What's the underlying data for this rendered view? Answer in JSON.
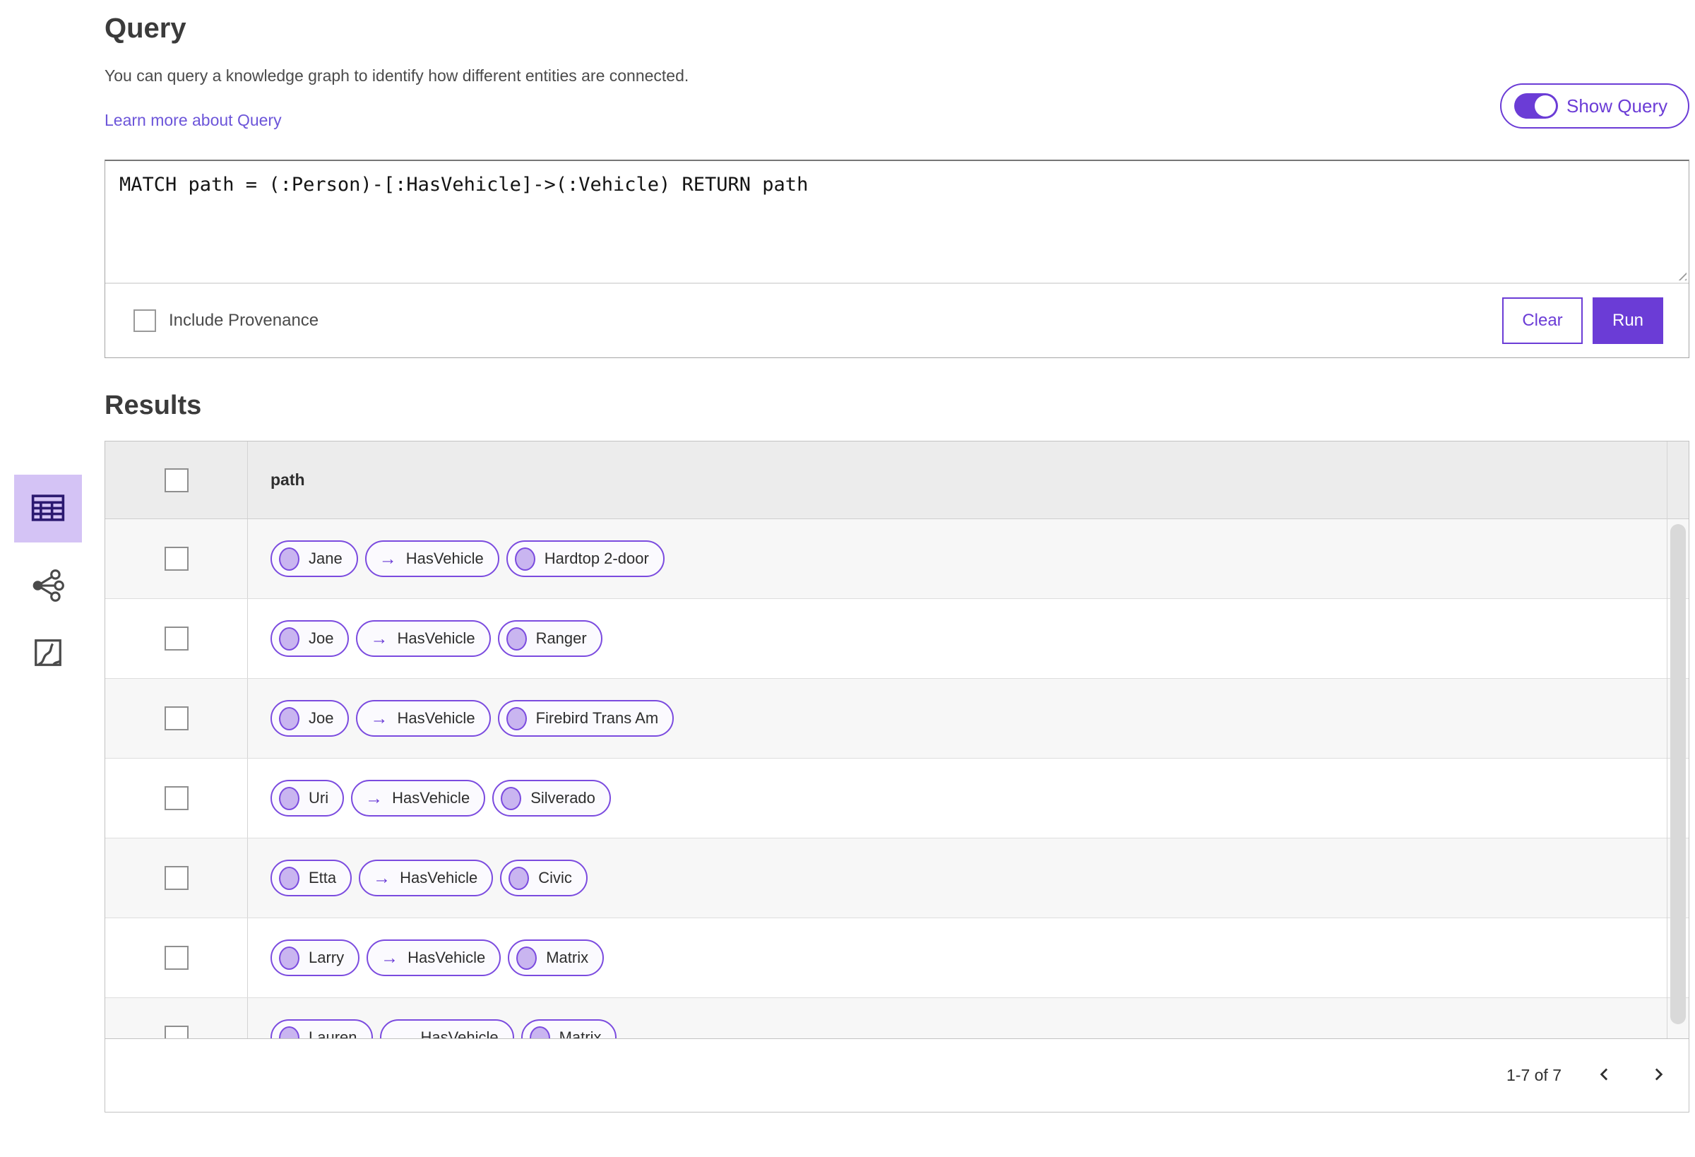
{
  "header": {
    "title": "Query",
    "description": "You can query a knowledge graph to identify how different entities are connected.",
    "learn_more_link": "Learn more about Query",
    "show_query_label": "Show Query",
    "show_query_on": true
  },
  "query_editor": {
    "query_text": "MATCH path = (:Person)-[:HasVehicle]->(:Vehicle) RETURN path",
    "include_provenance_label": "Include Provenance",
    "include_provenance_checked": false,
    "clear_button_label": "Clear",
    "run_button_label": "Run"
  },
  "results": {
    "title": "Results",
    "columns": [
      "path"
    ],
    "select_all_checked": false,
    "relationship_arrow": "→",
    "rows": [
      {
        "source": "Jane",
        "relationship": "HasVehicle",
        "target": "Hardtop 2-door"
      },
      {
        "source": "Joe",
        "relationship": "HasVehicle",
        "target": "Ranger"
      },
      {
        "source": "Joe",
        "relationship": "HasVehicle",
        "target": "Firebird Trans Am"
      },
      {
        "source": "Uri",
        "relationship": "HasVehicle",
        "target": "Silverado"
      },
      {
        "source": "Etta",
        "relationship": "HasVehicle",
        "target": "Civic"
      },
      {
        "source": "Larry",
        "relationship": "HasVehicle",
        "target": "Matrix"
      },
      {
        "source": "Lauren",
        "relationship": "HasVehicle",
        "target": "Matrix"
      }
    ],
    "pagination": {
      "range_label": "1-7 of 7"
    }
  },
  "sidebar": {
    "views": [
      {
        "name": "table-view",
        "icon": "table-icon",
        "selected": true
      },
      {
        "name": "link-chart-view",
        "icon": "link-chart-icon",
        "selected": false
      },
      {
        "name": "map-view",
        "icon": "map-icon",
        "selected": false
      }
    ]
  },
  "icons": {
    "toggle": "toggle-on-icon",
    "entity_node": "node-circle-icon",
    "relationship": "arrow-right-icon",
    "resize": "resize-grip-icon",
    "pagination_prev": "chevron-left-icon",
    "pagination_next": "chevron-right-icon"
  },
  "colors": {
    "accent_purple": "#6B3CD6",
    "pill_border": "#7B4BDF",
    "pill_node_fill": "#C9B5F0",
    "selected_view_background": "#D4C3F5",
    "link_purple": "#6C55D9",
    "table_header_background": "#ECECEC",
    "row_alt_background": "#F7F7F7"
  }
}
